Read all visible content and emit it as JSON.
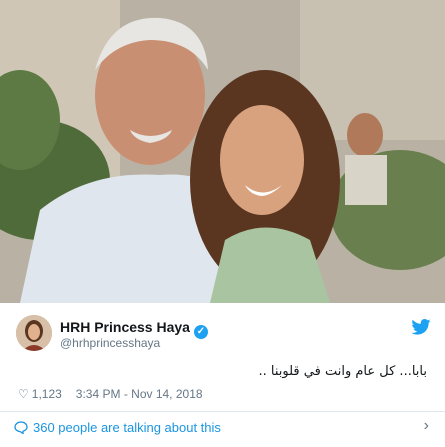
{
  "photo": {
    "description_icon": "photo-image"
  },
  "author": {
    "name": "HRH Princess Haya",
    "handle": "@hrhprincesshaya",
    "verified_icon": "verified-badge-icon"
  },
  "tweet": {
    "text": "بابا... كل عام وانت في قلوبنا ..",
    "likes": "1,123",
    "timestamp": "3:34 PM - Nov 14, 2018"
  },
  "footer": {
    "talking": "360 people are talking about this"
  },
  "colors": {
    "link": "#1b95e0",
    "verified": "#1da1f2",
    "muted": "#657786"
  }
}
